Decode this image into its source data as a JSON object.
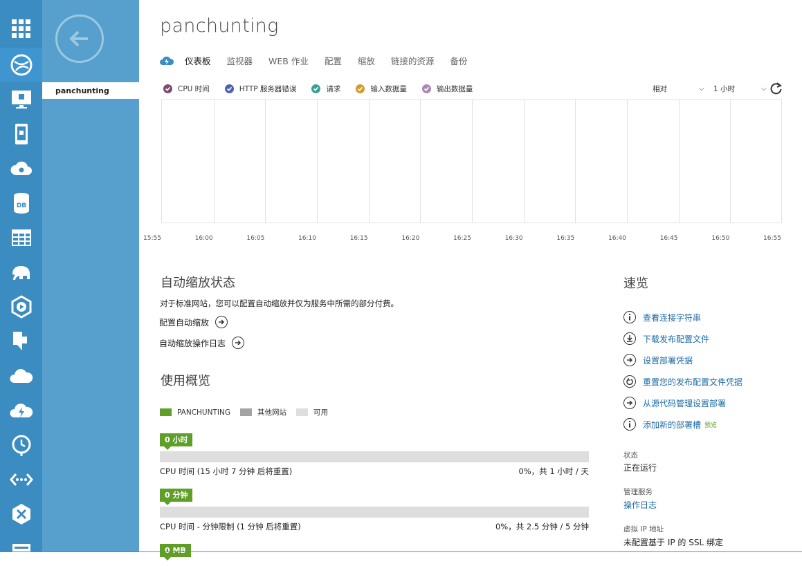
{
  "site_name": "panchunting",
  "subnav": {
    "current_item": "panchunting"
  },
  "tabs": [
    {
      "label": "仪表板",
      "active": true
    },
    {
      "label": "监视器"
    },
    {
      "label": "WEB 作业"
    },
    {
      "label": "配置"
    },
    {
      "label": "缩放"
    },
    {
      "label": "链接的资源"
    },
    {
      "label": "备份"
    }
  ],
  "metrics_legend": [
    {
      "label": "CPU 时间",
      "color": "#7b4b6e"
    },
    {
      "label": "HTTP 服务器错误",
      "color": "#4e62b4"
    },
    {
      "label": "请求",
      "color": "#3aa293"
    },
    {
      "label": "输入数据量",
      "color": "#d79a2a"
    },
    {
      "label": "输出数据量",
      "color": "#a98ab5"
    }
  ],
  "time_mode": "相对",
  "time_range": "1 小时",
  "chart_data": {
    "type": "line",
    "x": [
      "15:55",
      "16:00",
      "16:05",
      "16:10",
      "16:15",
      "16:20",
      "16:25",
      "16:30",
      "16:35",
      "16:40",
      "16:45",
      "16:50",
      "16:55"
    ],
    "series": [],
    "grid": true
  },
  "autoscale": {
    "title": "自动缩放状态",
    "description": "对于标准网站，您可以配置自动缩放并仅为服务中所需的部分付费。",
    "configure_link": "配置自动缩放",
    "log_link": "自动缩放操作日志"
  },
  "usage": {
    "title": "使用概览",
    "legend": [
      {
        "label": "PANCHUNTING",
        "color": "#5f9e27"
      },
      {
        "label": "其他网站",
        "color": "#a3a3a3"
      },
      {
        "label": "可用",
        "color": "#dedede"
      }
    ],
    "items": [
      {
        "badge": "0 小时",
        "label": "CPU 时间 (15 小时 7 分钟 后将重置)",
        "right": "0%，共 1 小时 / 天",
        "fill": 0
      },
      {
        "badge": "0 分钟",
        "label": "CPU 时间 - 分钟限制 (1 分钟 后将重置)",
        "right": "0%，共 2.5 分钟 / 5 分钟",
        "fill": 0
      },
      {
        "badge": "0 MB"
      }
    ]
  },
  "quick_glance": {
    "title": "速览",
    "links": [
      {
        "label": "查看连接字符串",
        "icon": "info-icon"
      },
      {
        "label": "下载发布配置文件",
        "icon": "download-icon"
      },
      {
        "label": "设置部署凭据",
        "icon": "arrow-right-icon"
      },
      {
        "label": "重置您的发布配置文件凭据",
        "icon": "reset-icon"
      },
      {
        "label": "从源代码管理设置部署",
        "icon": "arrow-right-icon"
      },
      {
        "label": "添加新的部署槽",
        "icon": "info-icon",
        "tag": "预览"
      }
    ],
    "status_label": "状态",
    "status_value": "正在运行",
    "mgmt_label": "管理服务",
    "mgmt_link": "操作日志",
    "vip_label": "虚拟 IP 地址",
    "vip_value": "未配置基于 IP 的 SSL 绑定"
  }
}
